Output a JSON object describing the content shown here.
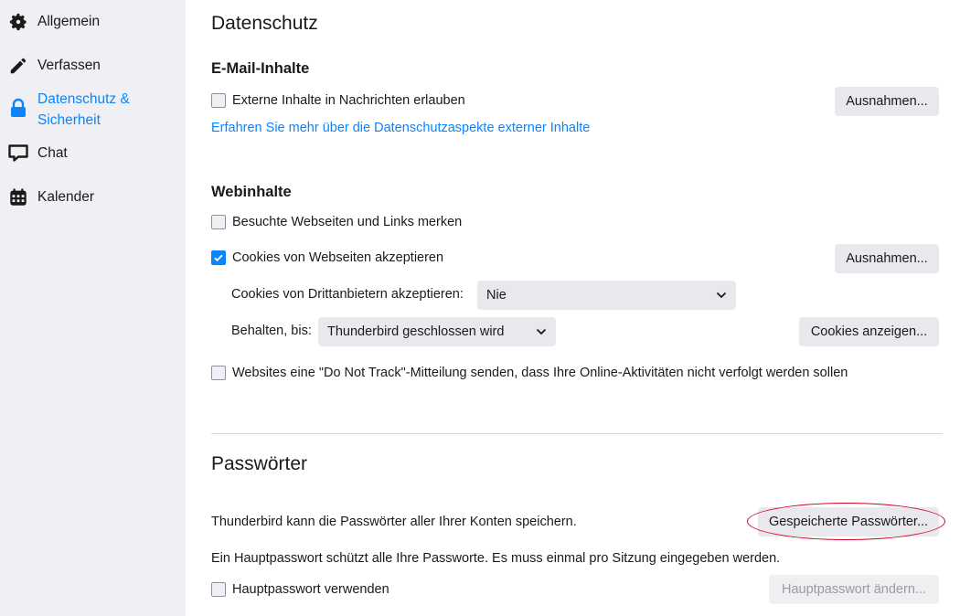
{
  "sidebar": {
    "items": [
      {
        "label": "Allgemein",
        "icon": "gear-icon"
      },
      {
        "label": "Verfassen",
        "icon": "pencil-icon"
      },
      {
        "label": "Datenschutz & Sicherheit",
        "icon": "lock-icon",
        "active": true
      },
      {
        "label": "Chat",
        "icon": "chat-bubble-icon"
      },
      {
        "label": "Kalender",
        "icon": "calendar-icon"
      }
    ]
  },
  "privacy": {
    "title": "Datenschutz",
    "email_section": {
      "heading": "E-Mail-Inhalte",
      "remote_content_label": "Externe Inhalte in Nachrichten erlauben",
      "remote_content_checked": false,
      "exceptions_button": "Ausnahmen...",
      "learn_more_link": "Erfahren Sie mehr über die Datenschutzaspekte externer Inhalte"
    },
    "web_section": {
      "heading": "Webinhalte",
      "history_label": "Besuchte Webseiten und Links merken",
      "history_checked": false,
      "cookies_label": "Cookies von Webseiten akzeptieren",
      "cookies_checked": true,
      "cookies_exceptions_button": "Ausnahmen...",
      "third_party_label": "Cookies von Drittanbietern akzeptieren:",
      "third_party_value": "Nie",
      "keep_until_label": "Behalten, bis:",
      "keep_until_value": "Thunderbird geschlossen wird",
      "show_cookies_button": "Cookies anzeigen...",
      "dnt_label": "Websites eine \"Do Not Track\"-Mitteilung senden, dass Ihre Online-Aktivitäten nicht verfolgt werden sollen",
      "dnt_checked": false
    }
  },
  "passwords": {
    "title": "Passwörter",
    "save_info": "Thunderbird kann die Passwörter aller Ihrer Konten speichern.",
    "saved_passwords_button": "Gespeicherte Passwörter...",
    "master_info": "Ein Hauptpasswort schützt alle Ihre Passworte. Es muss einmal pro Sitzung eingegeben werden.",
    "use_master_label": "Hauptpasswort verwenden",
    "use_master_checked": false,
    "change_master_button": "Hauptpasswort ändern..."
  },
  "colors": {
    "accent": "#0a84ff",
    "highlight_oval": "#d70022",
    "sidebar_bg": "#f0f0f4",
    "button_bg": "#e9e9ed"
  }
}
